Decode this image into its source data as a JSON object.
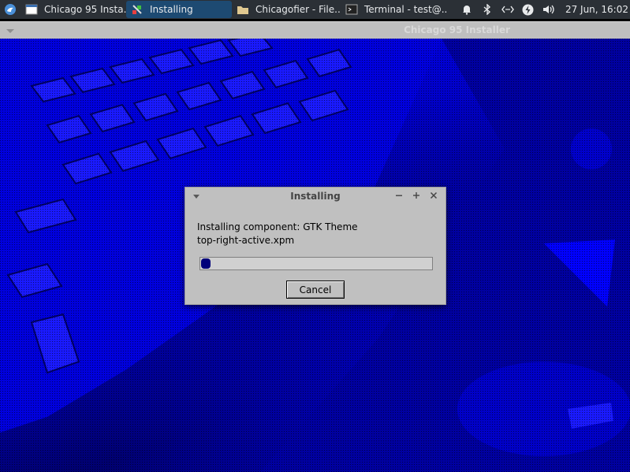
{
  "panel": {
    "tasks": [
      {
        "label": "Chicago 95 Insta...",
        "icon": "window-icon",
        "active": false
      },
      {
        "label": "Installing",
        "icon": "installer-icon",
        "active": true
      },
      {
        "label": "Chicagofier - File...",
        "icon": "folder-icon",
        "active": false
      },
      {
        "label": "Terminal - test@...",
        "icon": "terminal-icon",
        "active": false
      }
    ],
    "tray": [
      "bell-icon",
      "bluetooth-icon",
      "network-icon",
      "power-icon",
      "volume-icon"
    ],
    "clock": "27 Jun, 16:02"
  },
  "main_window": {
    "title": "Chicago 95 Installer"
  },
  "dialog": {
    "title": "Installing",
    "line1": "Installing component: GTK Theme",
    "line2": "top-right-active.xpm",
    "progress": 0.04,
    "cancel_label": "Cancel"
  },
  "colors": {
    "panel_bg": "#2b3036",
    "active_task": "#1d4a72",
    "dialog_bg": "#c0c0c0",
    "progress_fill": "#00007a",
    "wallpaper": "#0000ff"
  }
}
